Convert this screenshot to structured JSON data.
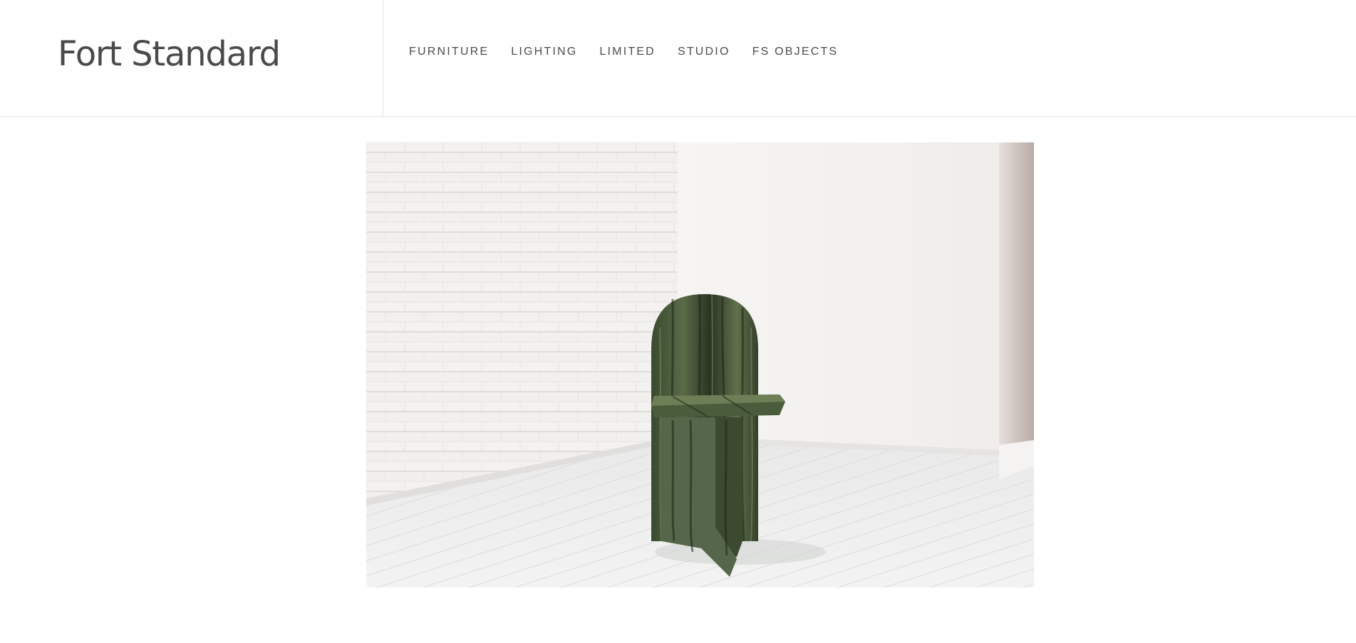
{
  "brand": {
    "name": "Fort Standard"
  },
  "nav": {
    "items": [
      {
        "label": "FURNITURE"
      },
      {
        "label": "LIGHTING"
      },
      {
        "label": "LIMITED"
      },
      {
        "label": "STUDIO"
      },
      {
        "label": "FS OBJECTS"
      }
    ]
  },
  "hero": {
    "subject": "green-stone-chair"
  },
  "colors": {
    "text": "#4a4a4a",
    "divider": "#e3e3e3",
    "background": "#ffffff"
  }
}
